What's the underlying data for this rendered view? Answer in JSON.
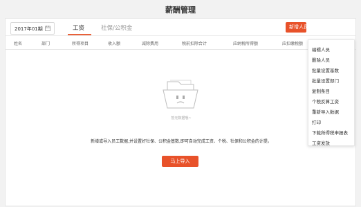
{
  "header": {
    "title": "薪酬管理"
  },
  "toolbar": {
    "date_value": "2017年01期",
    "tabs": [
      {
        "label": "工资",
        "active": true
      },
      {
        "label": "社保/公积金",
        "active": false
      }
    ],
    "new_button_label": "新增人员"
  },
  "table": {
    "columns": [
      "姓名",
      "部门",
      "所得项目",
      "收入额",
      "减除费用",
      "税前扣除合计",
      "应纳税所得额",
      "应扣缴税额"
    ]
  },
  "empty_state": {
    "text": "暂无数据哦~",
    "hint": "新增或导入员工数据,并设置好社保、公积金基数,即可自动完成工资、个税、社保和公积金的计提。",
    "import_button_label": "马上导入"
  },
  "dropdown": {
    "items": [
      "编辑人员",
      "删除人员",
      "批量设置基数",
      "批量设置部门",
      "复制条目",
      "个税反算工资",
      "重新导入数据",
      "打印",
      "下载所得税申报表",
      "工资发放"
    ]
  },
  "colors": {
    "accent": "#e8522a",
    "tab_underline": "#e8613a"
  }
}
